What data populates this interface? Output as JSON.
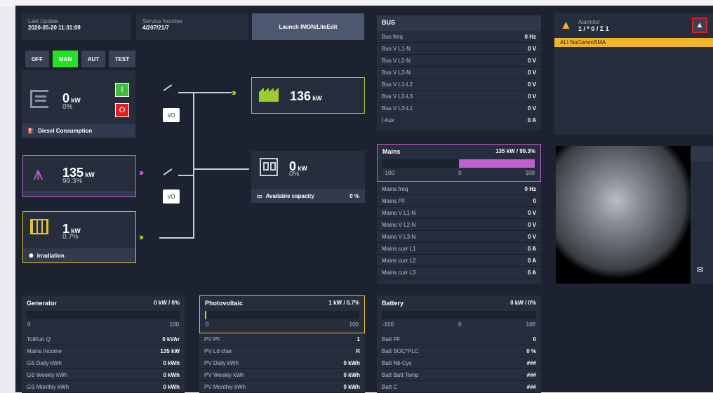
{
  "header": {
    "last_update_label": "Last Update",
    "last_update": "2020-05-20 11:31:09",
    "service_label": "Service Number",
    "service": "4/207/21/7",
    "launch": "Launch IMON/LiteEdit"
  },
  "modes": [
    "OFF",
    "MAN",
    "AUT",
    "TEST"
  ],
  "gen": {
    "power": "0",
    "unit": "kW",
    "pct": "0%",
    "on": "I",
    "off": "O",
    "strip": "Diesel Consumption"
  },
  "mains_block": {
    "power": "135",
    "unit": "kW",
    "pct": "99.3%"
  },
  "pv_block": {
    "power": "1",
    "unit": "kW",
    "pct": "0.7%",
    "strip": "Irradiation"
  },
  "io": "I/O",
  "load": {
    "power": "136",
    "unit": "kW"
  },
  "storage": {
    "power": "0",
    "unit": "kW",
    "pct": "0%",
    "strip": "Available capacity",
    "strip_val": "0 %"
  },
  "bus": {
    "title": "BUS",
    "rows": [
      [
        "Bus freq",
        "0 Hz"
      ],
      [
        "Bus V L1-N",
        "0 V"
      ],
      [
        "Bus V L2-N",
        "0 V"
      ],
      [
        "Bus V L3-N",
        "0 V"
      ],
      [
        "Bus V L1-L2",
        "0 V"
      ],
      [
        "Bus V L2-L3",
        "0 V"
      ],
      [
        "Bus V L3-L1",
        "0 V"
      ],
      [
        "I Aux",
        "0 A"
      ]
    ]
  },
  "alarm": {
    "title": "Alarmlist",
    "counts": "1 / * 0 / Σ 1",
    "item": "ALI NoCommSMA"
  },
  "mains": {
    "title": "Mains",
    "summary": "135 kW / 99.3%",
    "fill": 0.993,
    "scale": [
      "-100",
      "0",
      "100"
    ],
    "rows": [
      [
        "Mains freq",
        "0 Hz"
      ],
      [
        "Mains PF",
        "0"
      ],
      [
        "Mains V L1-N",
        "0 V"
      ],
      [
        "Mains V L2-N",
        "0 V"
      ],
      [
        "Mains V L3-N",
        "0 V"
      ],
      [
        "Mains curr L1",
        "0 A"
      ],
      [
        "Mains curr L2",
        "0 A"
      ],
      [
        "Mains curr L3",
        "0 A"
      ]
    ]
  },
  "generator": {
    "title": "Generator",
    "summary": "0 kW / 0%",
    "fill": 0,
    "scale": [
      "0",
      "100"
    ],
    "rows": [
      [
        "TotRun Q",
        "0 kVAr"
      ],
      [
        "Mains Income",
        "135 kW"
      ],
      [
        "GS Daily kWh",
        "0 kWh"
      ],
      [
        "GS Weekly kWh",
        "0 kWh"
      ],
      [
        "GS Monthly kWh",
        "0 kWh"
      ]
    ]
  },
  "photovoltaic": {
    "title": "Photovoltaic",
    "summary": "1 kW / 0.7%",
    "fill": 0.007,
    "scale": [
      "0",
      "100"
    ],
    "rows": [
      [
        "PV PF",
        "1"
      ],
      [
        "PV Ld char",
        "R"
      ],
      [
        "PV Daily kWh",
        "0 kWh"
      ],
      [
        "PV Weekly kWh",
        "0 kWh"
      ],
      [
        "PV Monthly kWh",
        "0 kWh"
      ]
    ]
  },
  "battery": {
    "title": "Battery",
    "summary": "0 kW / 0%",
    "fill": 0,
    "scale": [
      "-100",
      "0",
      "100"
    ],
    "rows": [
      [
        "Batt PF",
        "0"
      ],
      [
        "Batt SOC*PLC",
        "0 %"
      ],
      [
        "Batt Nb Cyc",
        "###"
      ],
      [
        "Batt Batt Temp",
        "###"
      ],
      [
        "Batt C",
        "###"
      ]
    ]
  },
  "colors": {
    "panel": "#1c2230",
    "card": "#262d3c",
    "green": "#3ddc3d",
    "purple": "#c060d0",
    "yellow": "#e8c030",
    "alarm": "#f0b429",
    "red": "#e02020"
  }
}
